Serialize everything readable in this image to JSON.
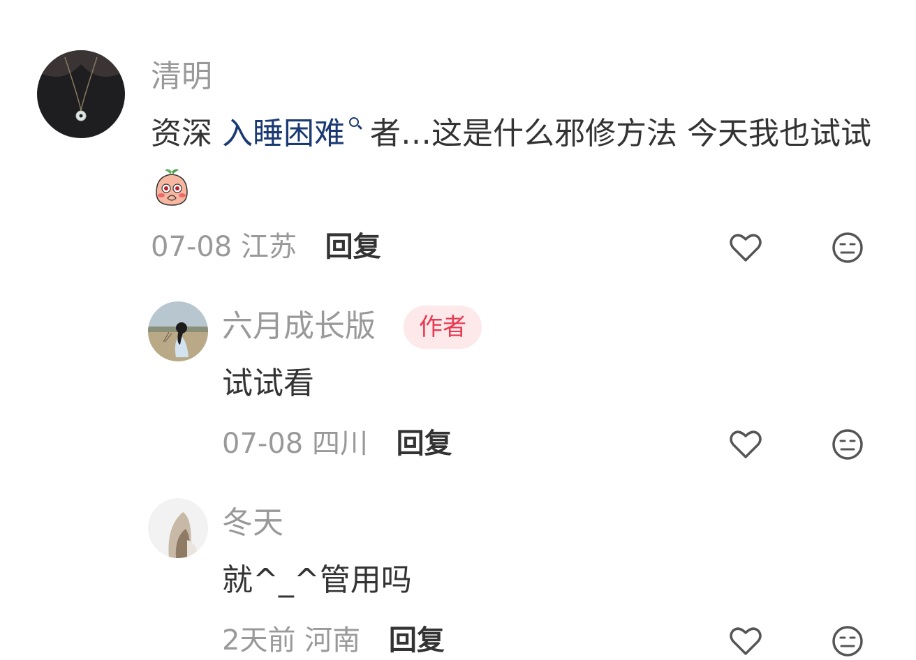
{
  "comments": [
    {
      "name": "清明",
      "text_before": "资深 ",
      "topic_link": "入睡困难",
      "text_after": "者…这是什么邪修方法 今天我也试试",
      "emoji": "shy-peach-emoji",
      "time": "07-08",
      "location": "江苏",
      "reply_label": "回复"
    },
    {
      "name": "六月成长版",
      "badge": "作者",
      "text": "试试看",
      "time": "07-08",
      "location": "四川",
      "reply_label": "回复"
    },
    {
      "name": "冬天",
      "text": "就^_^管用吗",
      "time": "2天前",
      "location": "河南",
      "reply_label": "回复"
    }
  ],
  "icons": {
    "like": "heart-outline-icon",
    "dislike": "neutral-face-icon",
    "link_search": "search-icon"
  },
  "colors": {
    "name": "#999999",
    "text": "#333333",
    "topic_link": "#1b3a73",
    "badge_bg": "#fde8ea",
    "badge_text": "#e83a52"
  }
}
